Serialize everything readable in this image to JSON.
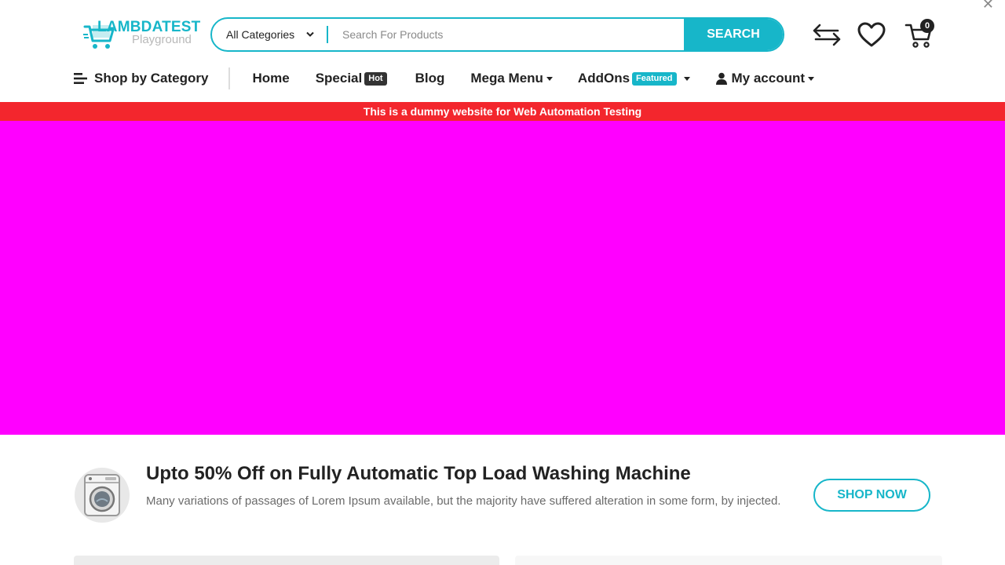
{
  "header": {
    "logo": {
      "main": "LAMBDATEST",
      "sub": "Playground"
    },
    "search": {
      "category": "All Categories",
      "placeholder": "Search For Products",
      "button_label": "SEARCH"
    },
    "cart_count": "0",
    "icons": [
      "compare-icon",
      "wishlist-heart-icon",
      "cart-icon"
    ]
  },
  "nav": {
    "shop_by_category": "Shop by Category",
    "home": "Home",
    "special": "Special",
    "special_badge": "Hot",
    "blog": "Blog",
    "mega_menu": "Mega Menu",
    "addons": "AddOns",
    "addons_badge": "Featured",
    "account": "My account"
  },
  "notice": "This is a dummy website for Web Automation Testing",
  "promo": {
    "title": "Upto 50% Off on Fully Automatic Top Load Washing Machine",
    "description": "Many variations of passages of Lorem Ipsum available, but the majority have suffered alteration in some form, by injected.",
    "button_label": "SHOP NOW"
  },
  "colors": {
    "accent": "#17b6c9",
    "notice_bg": "#f3262d",
    "hero_bg": "#ff00ff",
    "text": "#222222"
  }
}
